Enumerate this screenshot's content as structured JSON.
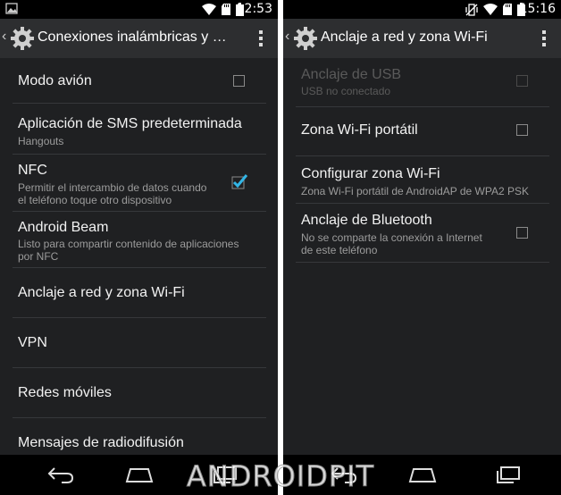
{
  "left": {
    "status": {
      "time": "12:53",
      "icons": [
        "image-icon",
        "wifi-icon",
        "sd-card-icon",
        "battery-icon"
      ]
    },
    "actionbar": {
      "title": "Conexiones inalámbricas y r..."
    },
    "items": [
      {
        "label": "Modo avión",
        "sub": "",
        "checkbox": true,
        "checked": false
      },
      {
        "label": "Aplicación de SMS predeterminada",
        "sub": "Hangouts"
      },
      {
        "label": "NFC",
        "sub": "Permitir el intercambio de datos cuando",
        "sub2": "el teléfono toque otro dispositivo",
        "checkbox": true,
        "checked": true
      },
      {
        "label": "Android Beam",
        "sub": "Listo para compartir contenido de aplicaciones",
        "sub2": "por NFC"
      },
      {
        "label": "Anclaje a red y zona Wi-Fi"
      },
      {
        "label": "VPN"
      },
      {
        "label": "Redes móviles"
      },
      {
        "label": "Mensajes de radiodifusión"
      }
    ]
  },
  "right": {
    "status": {
      "time": "15:16",
      "icons": [
        "vibrate-icon",
        "wifi-icon",
        "sd-card-icon",
        "battery-icon"
      ]
    },
    "actionbar": {
      "title": "Anclaje a red y zona Wi-Fi"
    },
    "items": [
      {
        "label": "Anclaje de USB",
        "sub": "USB no conectado",
        "checkbox": true,
        "checked": false,
        "disabled": true
      },
      {
        "label": "Zona Wi-Fi portátil",
        "checkbox": true,
        "checked": false
      },
      {
        "label": "Configurar zona Wi-Fi",
        "sub": "Zona Wi-Fi portátil de AndroidAP de WPA2 PSK"
      },
      {
        "label": "Anclaje de Bluetooth",
        "sub": "No se comparte la conexión a Internet",
        "sub2": "de este teléfono",
        "checkbox": true,
        "checked": false
      }
    ]
  },
  "watermark": "ANDROIDPIT",
  "colors": {
    "background": "#1f2022",
    "actionbar": "#2d2e30",
    "accent": "#33b5e5",
    "divider": "#36383b"
  }
}
